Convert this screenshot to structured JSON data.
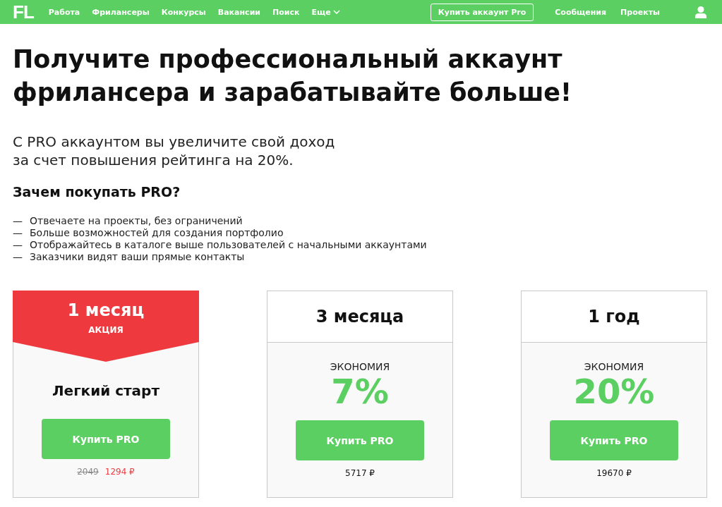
{
  "header": {
    "logo": "FL",
    "nav": [
      {
        "label": "Работа",
        "dropdown": false
      },
      {
        "label": "Фрилансеры",
        "dropdown": false
      },
      {
        "label": "Конкурсы",
        "dropdown": false
      },
      {
        "label": "Вакансии",
        "dropdown": false
      },
      {
        "label": "Поиск",
        "dropdown": false
      },
      {
        "label": "Еще",
        "dropdown": true
      }
    ],
    "pro_button": "Купить аккаунт Pro",
    "links": [
      "Сообщения",
      "Проекты"
    ]
  },
  "hero": {
    "title_lines": [
      "Получите профессиональный аккаунт",
      "фрилансера и зарабатывайте больше!"
    ],
    "subtitle_lines": [
      "С PRO аккаунтом вы увеличите свой доход",
      "за счет повышения рейтинга на 20%."
    ]
  },
  "why": {
    "heading": "Зачем покупать PRO?",
    "items": [
      {
        "marker": "—",
        "text": "Отвечаете на проекты, без ограничений"
      },
      {
        "marker": "—",
        "text": "Больше возможностей для создания портфолио"
      },
      {
        "marker": "—",
        "text": "Отображайтесь в каталоге выше пользователей с начальными аккаунтами"
      },
      {
        "marker": "—",
        "text": "Заказчики видят ваши прямые контакты"
      }
    ]
  },
  "plans": [
    {
      "kind": "promo",
      "title": "1 месяц",
      "badge": "АКЦИЯ",
      "tagline": "Легкий старт",
      "button": "Купить PRO",
      "old_price": "2049",
      "price": "1294 ₽"
    },
    {
      "kind": "standard",
      "title": "3 месяца",
      "savings_label": "ЭКОНОМИЯ",
      "savings": "7%",
      "button": "Купить PRO",
      "price": "5717 ₽"
    },
    {
      "kind": "standard",
      "title": "1 год",
      "savings_label": "ЭКОНОМИЯ",
      "savings": "20%",
      "button": "Купить PRO",
      "price": "19670 ₽"
    }
  ]
}
